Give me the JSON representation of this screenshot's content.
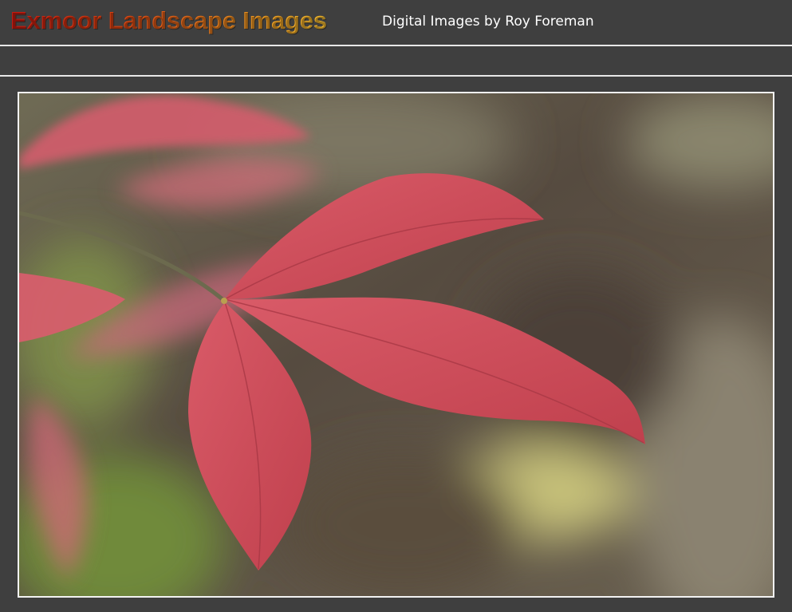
{
  "header": {
    "title": "Exmoor Landscape Images",
    "subtitle": "Digital Images by Roy Foreman"
  },
  "photo": {
    "subject": "red-leaves-photo",
    "colors": {
      "leaf": "#d04e5a",
      "background": "#5b5246",
      "frame": "#f2f2f2"
    }
  }
}
